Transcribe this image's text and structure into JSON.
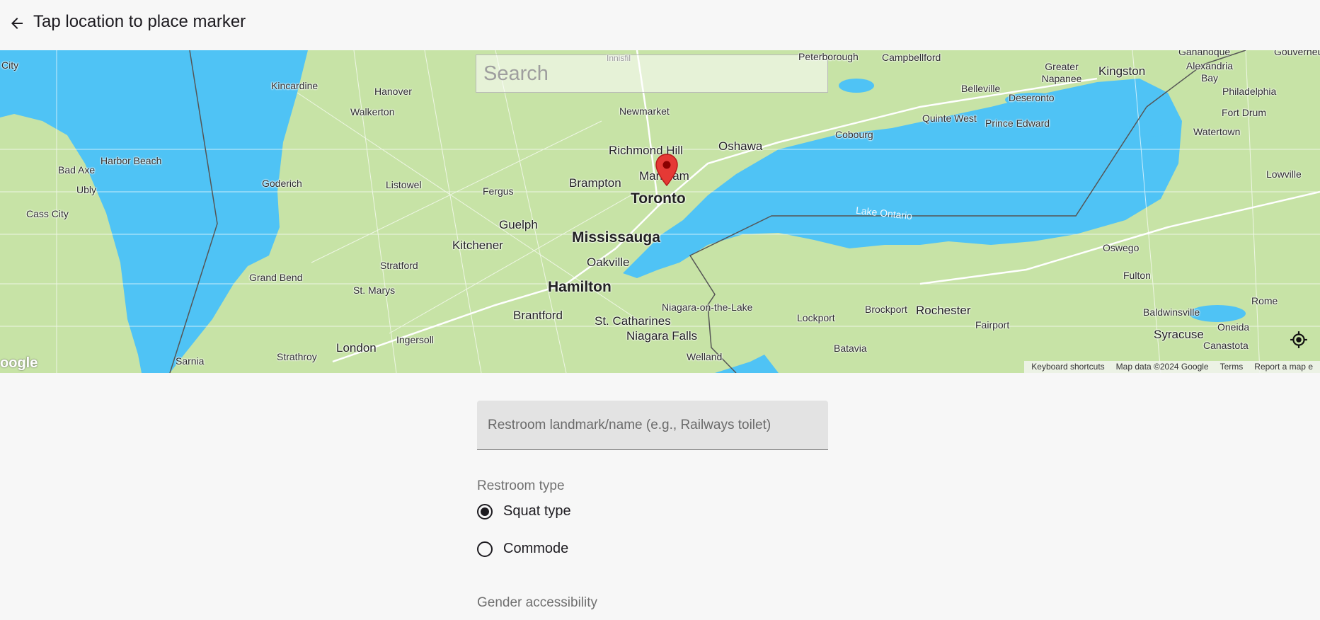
{
  "appbar": {
    "back_icon": "arrow-back-icon",
    "title": "Tap location to place marker"
  },
  "map": {
    "search_placeholder": "Search",
    "labels": {
      "city": "City",
      "kincardine": "Kincardine",
      "hanover": "Hanover",
      "walkerton": "Walkerton",
      "harbor_beach": "Harbor Beach",
      "bad_axe": "Bad Axe",
      "ubly": "Ubly",
      "cass_city": "Cass City",
      "goderich": "Goderich",
      "listowel": "Listowel",
      "fergus": "Fergus",
      "newmarket": "Newmarket",
      "richmond_hill": "Richmond Hill",
      "markham": "Markham",
      "oshawa": "Oshawa",
      "brampton": "Brampton",
      "toronto": "Toronto",
      "guelph": "Guelph",
      "kitchener": "Kitchener",
      "mississauga": "Mississauga",
      "oakville": "Oakville",
      "stratford": "Stratford",
      "st_marys": "St. Marys",
      "grand_bend": "Grand Bend",
      "hamilton": "Hamilton",
      "brantford": "Brantford",
      "st_catharines": "St. Catharines",
      "niagara_falls": "Niagara Falls",
      "niagara_on_the_lake": "Niagara-on-the-Lake",
      "welland": "Welland",
      "london": "London",
      "ingersoll": "Ingersoll",
      "strathroy": "Strathroy",
      "sarnia": "Sarnia",
      "peterborough": "Peterborough",
      "campbellford": "Campbellford",
      "cobourg": "Cobourg",
      "belleville": "Belleville",
      "greater_napanee": "Greater Napanee",
      "deseronto": "Deseronto",
      "quinte_west": "Quinte West",
      "prince_edward": "Prince Edward",
      "kingston": "Kingston",
      "gananoque": "Gananoque",
      "alexandria_bay": "Alexandria Bay",
      "philadelphia": "Philadelphia",
      "fort_drum": "Fort Drum",
      "watertown": "Watertown",
      "lowville": "Lowville",
      "gouverneur": "Gouverneur",
      "lake_ontario": "Lake Ontario",
      "oswego": "Oswego",
      "fulton": "Fulton",
      "rome": "Rome",
      "baldwinsville": "Baldwinsville",
      "oneida": "Oneida",
      "syracuse": "Syracuse",
      "canastota": "Canastota",
      "rochester": "Rochester",
      "fairport": "Fairport",
      "brockport": "Brockport",
      "lockport": "Lockport",
      "batavia": "Batavia",
      "innisfil": "Innisfil"
    },
    "attribution": {
      "keyboard_shortcuts": "Keyboard shortcuts",
      "map_data": "Map data ©2024 Google",
      "terms": "Terms",
      "report": "Report a map e"
    },
    "logo_text": "oogle",
    "marker_icon": "map-pin-icon",
    "locate_icon": "my-location-icon",
    "colors": {
      "water": "#4fc3f5",
      "land": "#c7e3a6",
      "marker": "#e53935"
    }
  },
  "form": {
    "name_placeholder": "Restroom landmark/name (e.g., Railways toilet)",
    "restroom_type_label": "Restroom type",
    "restroom_types": [
      {
        "label": "Squat type",
        "selected": true
      },
      {
        "label": "Commode",
        "selected": false
      }
    ],
    "gender_label": "Gender accessibility"
  }
}
